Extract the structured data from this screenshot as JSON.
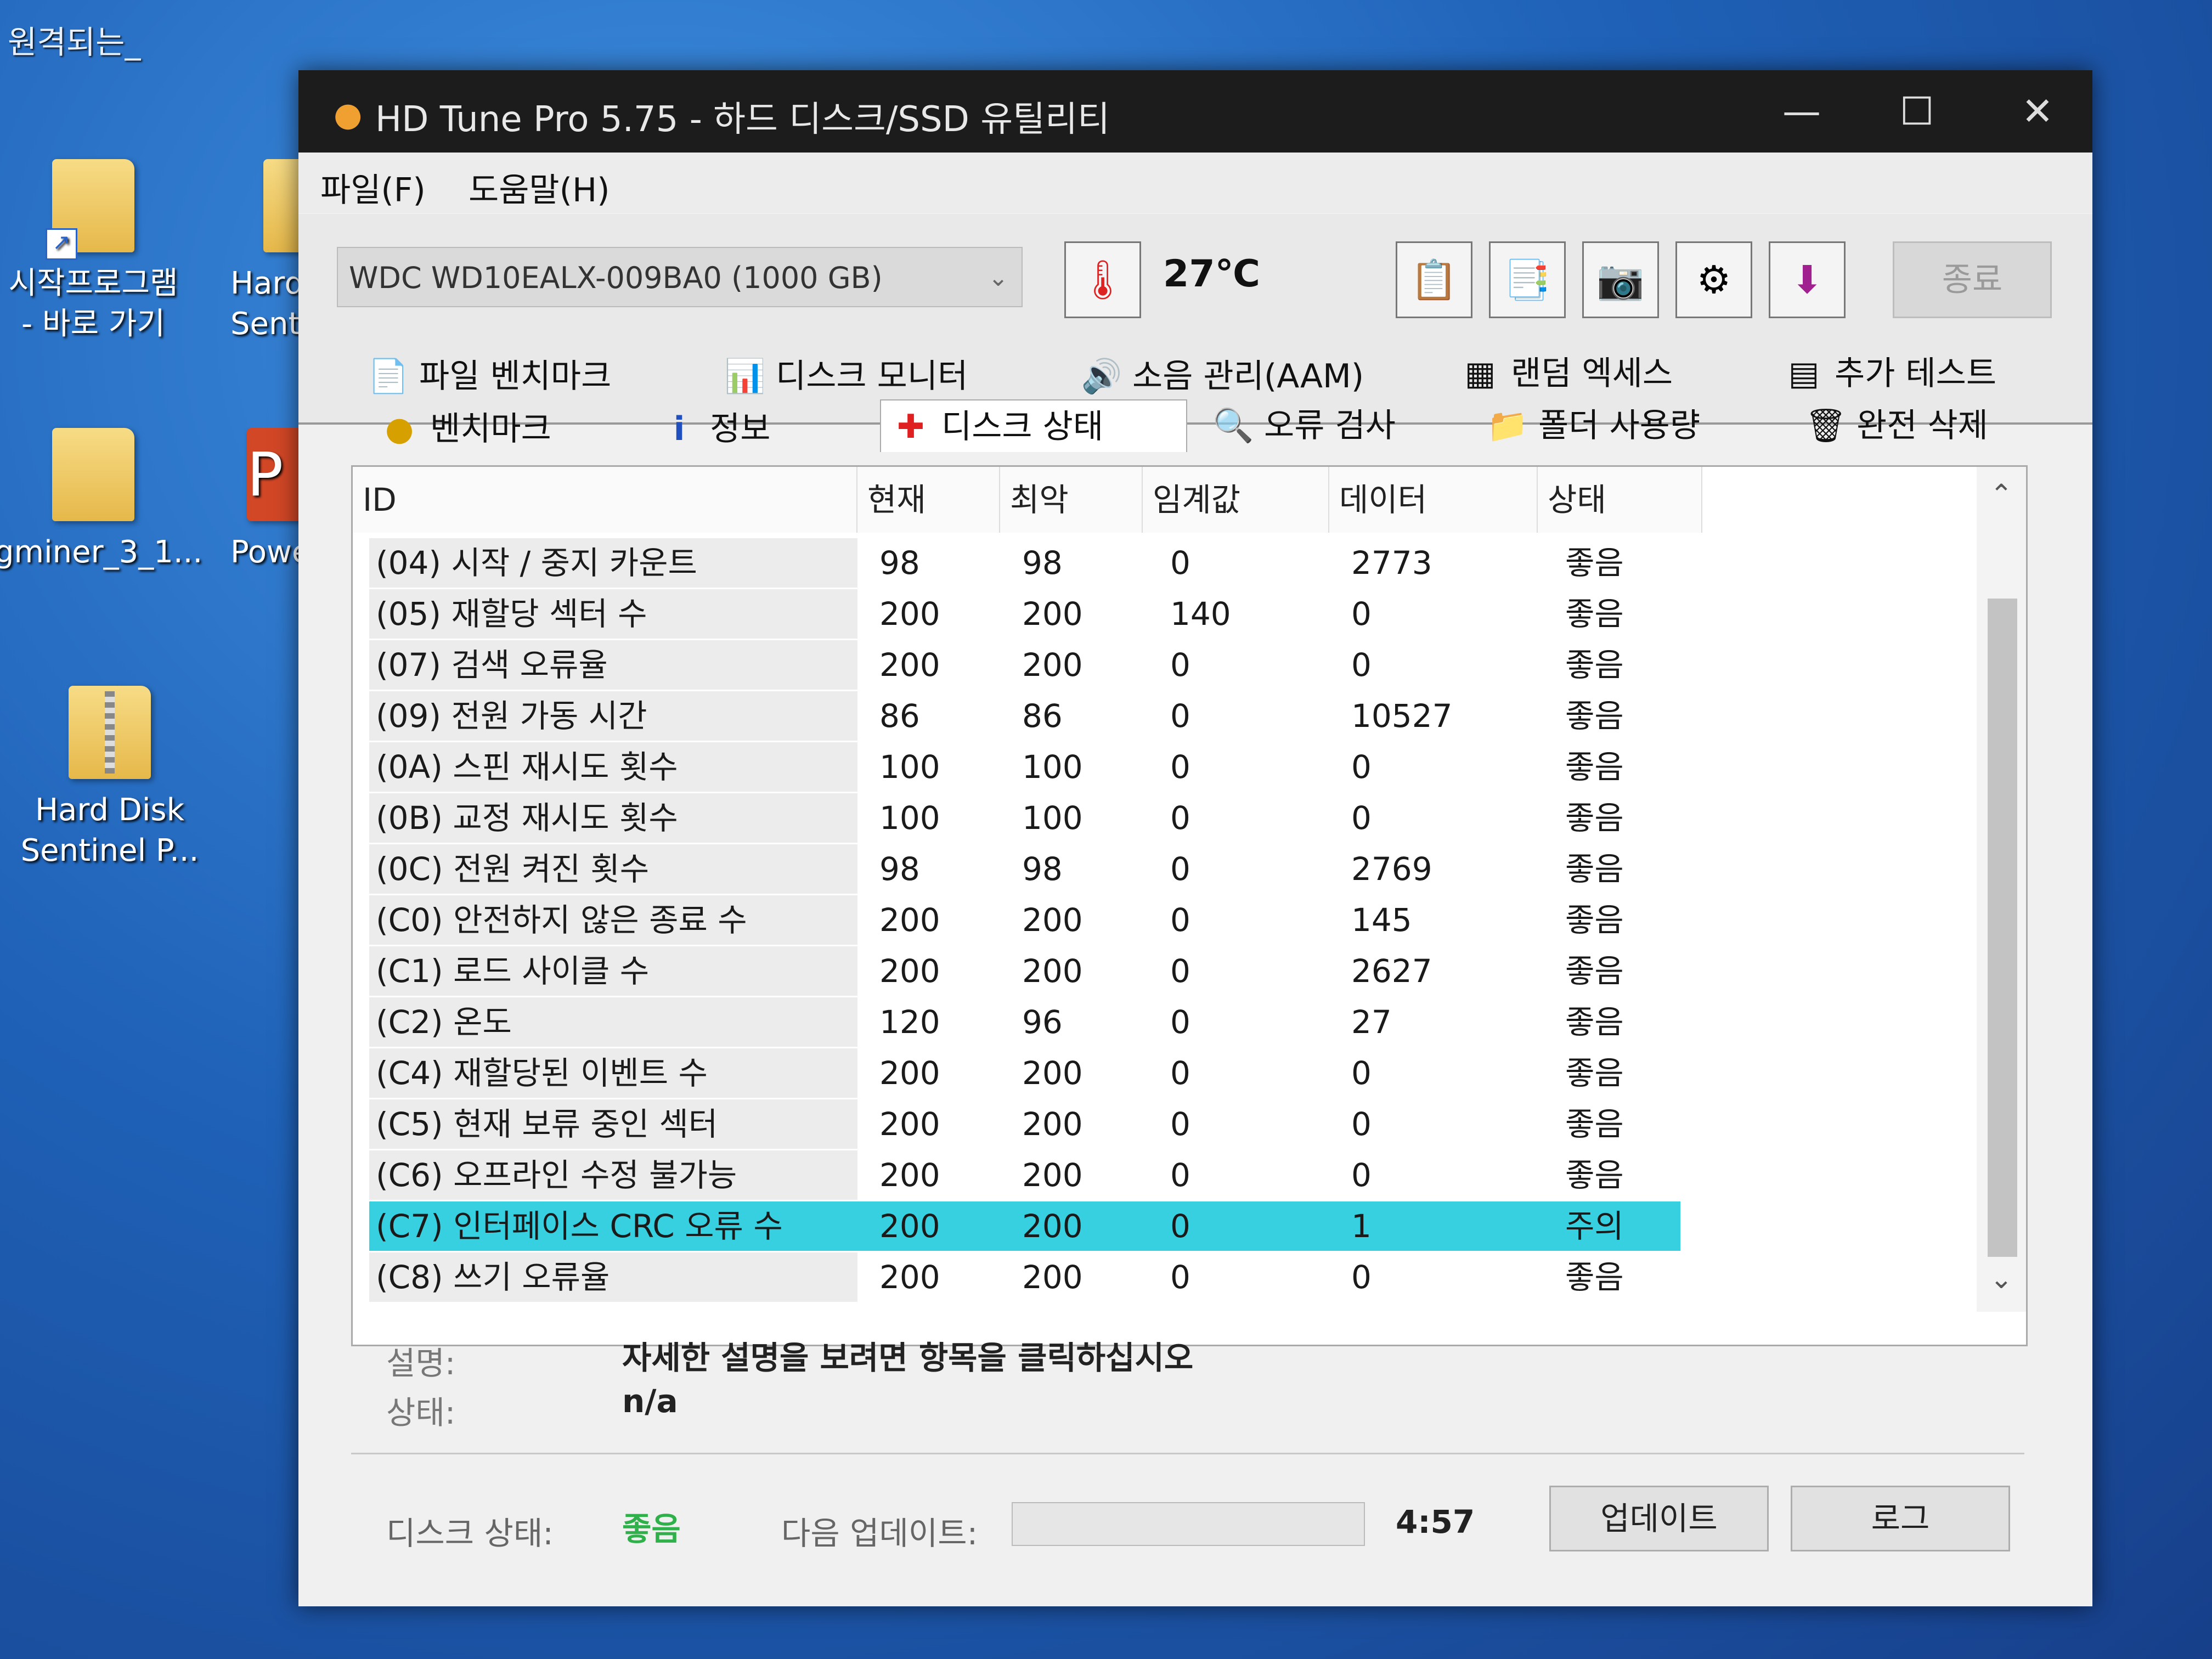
{
  "desktop": {
    "top_label": "원격되는_",
    "icons": [
      {
        "label": "시작프로그램\n- 바로 가기"
      },
      {
        "label": "Hard\nSenti"
      },
      {
        "label": "gminer_3_1..."
      },
      {
        "label": "Powe"
      },
      {
        "label": "Hard Disk\nSentinel P..."
      }
    ]
  },
  "window": {
    "title": "HD Tune Pro 5.75 - 하드 디스크/SSD 유틸리티",
    "menu": [
      "파일(F)",
      "도움말(H)"
    ],
    "drive": "WDC WD10EALX-009BA0 (1000 GB)",
    "temperature": "27℃",
    "exit_label": "종료",
    "tabs_row1": [
      "파일 벤치마크",
      "디스크 모니터",
      "소음 관리(AAM)",
      "랜덤 엑세스",
      "추가 테스트"
    ],
    "tabs_row2": [
      "벤치마크",
      "정보",
      "디스크 상태",
      "오류 검사",
      "폴더 사용량",
      "완전 삭제"
    ],
    "active_tab": "디스크 상태",
    "columns": [
      "ID",
      "현재",
      "최악",
      "임계값",
      "데이터",
      "상태"
    ],
    "rows": [
      {
        "id": "(04) 시작 / 중지 카운트",
        "current": "98",
        "worst": "98",
        "threshold": "0",
        "data": "2773",
        "status": "좋음"
      },
      {
        "id": "(05) 재할당 섹터 수",
        "current": "200",
        "worst": "200",
        "threshold": "140",
        "data": "0",
        "status": "좋음"
      },
      {
        "id": "(07) 검색 오류율",
        "current": "200",
        "worst": "200",
        "threshold": "0",
        "data": "0",
        "status": "좋음"
      },
      {
        "id": "(09) 전원 가동 시간",
        "current": "86",
        "worst": "86",
        "threshold": "0",
        "data": "10527",
        "status": "좋음"
      },
      {
        "id": "(0A) 스핀 재시도 횟수",
        "current": "100",
        "worst": "100",
        "threshold": "0",
        "data": "0",
        "status": "좋음"
      },
      {
        "id": "(0B) 교정 재시도 횟수",
        "current": "100",
        "worst": "100",
        "threshold": "0",
        "data": "0",
        "status": "좋음"
      },
      {
        "id": "(0C) 전원 켜진 횟수",
        "current": "98",
        "worst": "98",
        "threshold": "0",
        "data": "2769",
        "status": "좋음"
      },
      {
        "id": "(C0) 안전하지 않은 종료 수",
        "current": "200",
        "worst": "200",
        "threshold": "0",
        "data": "145",
        "status": "좋음"
      },
      {
        "id": "(C1) 로드 사이클 수",
        "current": "200",
        "worst": "200",
        "threshold": "0",
        "data": "2627",
        "status": "좋음"
      },
      {
        "id": "(C2) 온도",
        "current": "120",
        "worst": "96",
        "threshold": "0",
        "data": "27",
        "status": "좋음"
      },
      {
        "id": "(C4) 재할당된 이벤트 수",
        "current": "200",
        "worst": "200",
        "threshold": "0",
        "data": "0",
        "status": "좋음"
      },
      {
        "id": "(C5) 현재 보류 중인 섹터",
        "current": "200",
        "worst": "200",
        "threshold": "0",
        "data": "0",
        "status": "좋음"
      },
      {
        "id": "(C6) 오프라인 수정 불가능",
        "current": "200",
        "worst": "200",
        "threshold": "0",
        "data": "0",
        "status": "좋음"
      },
      {
        "id": "(C7) 인터페이스 CRC 오류 수",
        "current": "200",
        "worst": "200",
        "threshold": "0",
        "data": "1",
        "status": "주의"
      },
      {
        "id": "(C8) 쓰기 오류율",
        "current": "200",
        "worst": "200",
        "threshold": "0",
        "data": "0",
        "status": "좋음"
      }
    ],
    "selected_row_index": 13,
    "highlight_color": "#37d0e0",
    "description_label": "설명:",
    "description_text": "자세한 설명을 보려면 항목을 클릭하십시오",
    "status_label": "상태:",
    "status_text": "n/a",
    "disk_status_label": "디스크 상태:",
    "disk_status_value": "좋음",
    "next_update_label": "다음 업데이트:",
    "next_update_progress": 0.0,
    "countdown": "4:57",
    "update_button": "업데이트",
    "log_button": "로그",
    "good_color": "#2fb04a"
  }
}
